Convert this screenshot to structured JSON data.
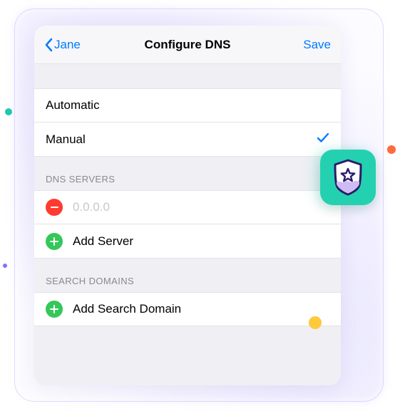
{
  "navbar": {
    "back_label": "Jane",
    "title": "Configure DNS",
    "save_label": "Save"
  },
  "mode": {
    "options": [
      "Automatic",
      "Manual"
    ],
    "selected": "Manual"
  },
  "dns_servers": {
    "header": "DNS SERVERS",
    "entry_value": "",
    "entry_placeholder": "0.0.0.0",
    "add_label": "Add Server"
  },
  "search_domains": {
    "header": "SEARCH DOMAINS",
    "add_label": "Add Search Domain"
  },
  "app_icon": "shield-star",
  "colors": {
    "ios_blue": "#007aff",
    "ios_red": "#ff3b30",
    "ios_green": "#34c759",
    "app_teal": "#23d1b0"
  }
}
